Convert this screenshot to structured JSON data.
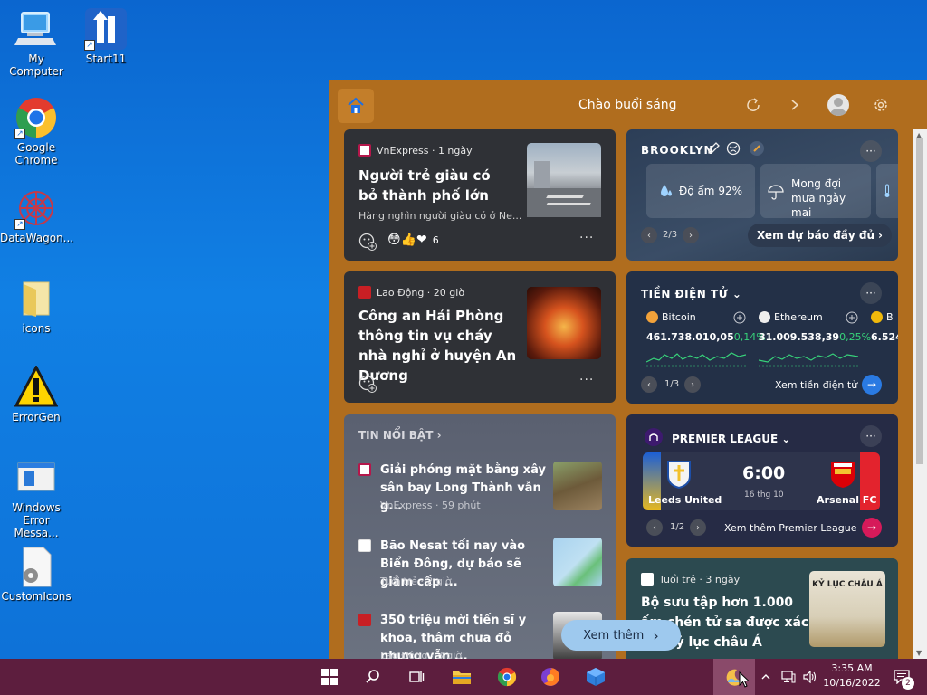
{
  "desktop": {
    "icons": [
      {
        "label": "My Computer"
      },
      {
        "label": "Start11"
      },
      {
        "label": "Google Chrome"
      },
      {
        "label": "DataWagon..."
      },
      {
        "label": "icons"
      },
      {
        "label": "ErrorGen"
      },
      {
        "label": "Windows Error Messa..."
      },
      {
        "label": "CustomIcons"
      }
    ]
  },
  "widgets": {
    "greeting": "Chào buổi sáng",
    "news1": {
      "source": "VnExpress · 1 ngày",
      "title": "Người trẻ giàu có bỏ thành phố lớn",
      "snippet": "Hàng nghìn người giàu có ở Ne...",
      "reactions": "6"
    },
    "news2": {
      "source": "Lao Động · 20 giờ",
      "title": "Công an Hải Phòng thông tin vụ cháy nhà nghỉ ở huyện An Dương"
    },
    "weather": {
      "location": "BROOKLYN",
      "humidity": "Độ ẩm 92%",
      "rain": "Mong đợi mưa ngày mai",
      "pager": "2/3",
      "link": "Xem dự báo đầy đủ"
    },
    "crypto": {
      "title": "TIỀN ĐIỆN TỬ",
      "coins": [
        {
          "name": "Bitcoin",
          "price": "461.738.010,05",
          "change": "0,14%"
        },
        {
          "name": "Ethereum",
          "price": "31.009.538,39",
          "change": "0,25%"
        },
        {
          "name": "B",
          "price": "6.524"
        }
      ],
      "pager": "1/3",
      "link": "Xem tiền điện tử"
    },
    "highlights": {
      "header": "TIN NỔI BẬT",
      "items": [
        {
          "title": "Giải phóng mặt bằng xây sân bay Long Thành vẫn g...",
          "meta": "VnExpress · 59 phút"
        },
        {
          "title": "Bão Nesat tối nay vào Biển Đông, dự báo sẽ giảm cấp ...",
          "meta": "Tuổi trẻ · 2 giờ"
        },
        {
          "title": "350 triệu mời tiến sĩ y khoa, thâm chưa đỏ nhưng vẫn ...",
          "meta": "Lao Động · 3 giờ"
        }
      ]
    },
    "league": {
      "title": "PREMIER LEAGUE",
      "home": "Leeds United",
      "away": "Arsenal FC",
      "time": "6:00",
      "date": "16 thg 10",
      "pager": "1/2",
      "link": "Xem thêm Premier League"
    },
    "news3": {
      "source": "Tuổi trẻ · 3 ngày",
      "title": "Bộ sưu tập hơn 1.000 ấm chén tử sa được xác lập kỷ lục châu Á",
      "img_text": "KỶ LỤC CHÂU Á"
    },
    "more_button": "Xem thêm"
  },
  "taskbar": {
    "time": "3:35 AM",
    "date": "10/16/2022",
    "notif_count": "2"
  },
  "colors": {
    "panel": "#b06d1e",
    "card": "#2f3136",
    "taskbar": "#5d1e3e",
    "desktop": "#0b66cf",
    "up": "#37d37a"
  }
}
